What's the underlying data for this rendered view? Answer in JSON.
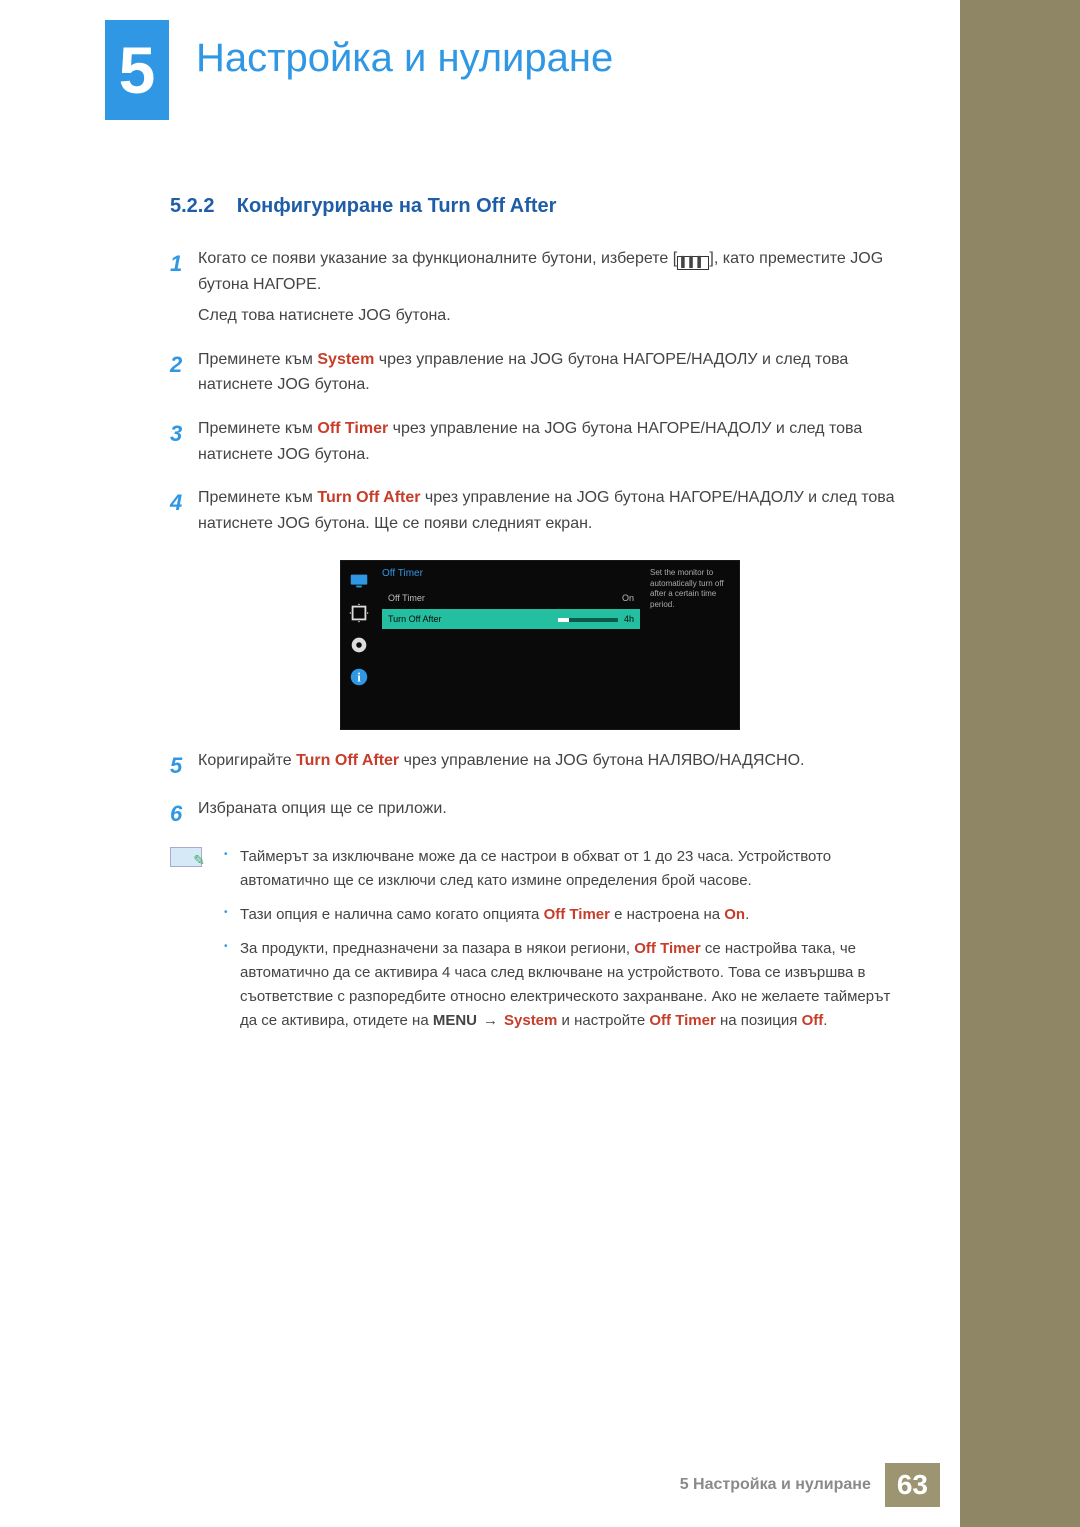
{
  "header": {
    "chapter_num": "5",
    "chapter_title": "Настройка и нулиране"
  },
  "section": {
    "number": "5.2.2",
    "title": "Конфигуриране на Turn Off After"
  },
  "steps": {
    "s1": {
      "num": "1",
      "p1a": "Когато се появи указание за функционалните бутони, изберете [",
      "p1b": "], като преместите JOG бутона НАГОРЕ.",
      "p2": "След това натиснете JOG бутона."
    },
    "s2": {
      "num": "2",
      "p_a": "Преминете към ",
      "kw": "System",
      "p_b": " чрез управление на JOG бутона НАГОРЕ/НАДОЛУ и след това натиснете JOG бутона."
    },
    "s3": {
      "num": "3",
      "p_a": "Преминете към ",
      "kw": "Off Timer",
      "p_b": " чрез управление на JOG бутона НАГОРЕ/НАДОЛУ и след това натиснете JOG бутона."
    },
    "s4": {
      "num": "4",
      "p_a": "Преминете към ",
      "kw": "Turn Off After",
      "p_b": " чрез управление на JOG бутона НАГОРЕ/НАДОЛУ и след това натиснете JOG бутона. Ще се появи следният екран."
    },
    "s5": {
      "num": "5",
      "p_a": "Коригирайте ",
      "kw": "Turn Off After",
      "p_b": " чрез управление на JOG бутона НАЛЯВО/НАДЯСНО."
    },
    "s6": {
      "num": "6",
      "p": "Избраната опция ще се приложи."
    }
  },
  "osd": {
    "breadcrumb": "Off Timer",
    "row1": {
      "label": "Off Timer",
      "value": "On"
    },
    "row2": {
      "label": "Turn Off After",
      "value": "4h"
    },
    "help": "Set the monitor to automatically turn off after a certain time period."
  },
  "notes": {
    "n1": "Таймерът за изключване може да се настрои в обхват от 1 до 23 часа. Устройството автоматично ще се изключи след като измине определения брой часове.",
    "n2_a": "Тази опция е налична само когато опцията ",
    "n2_kw1": "Off Timer",
    "n2_b": " е настроена на ",
    "n2_kw2": "On",
    "n2_c": ".",
    "n3_a": "За продукти, предназначени за пазара в някои региони, ",
    "n3_kw1": "Off Timer",
    "n3_b": " се настройва така, че автоматично да се активира 4 часа след включване на устройството. Това се извършва в съответствие с разпоредбите относно електрическото захранване. Ако не желаете таймерът да се активира, отидете на ",
    "n3_kw2": "MENU",
    "n3_arrow": "→",
    "n3_kw3": "System",
    "n3_c": " и настройте ",
    "n3_kw4": "Off Timer",
    "n3_d": " на позиция ",
    "n3_kw5": "Off",
    "n3_e": "."
  },
  "footer": {
    "label": "5 Настройка и нулиране",
    "page": "63"
  }
}
